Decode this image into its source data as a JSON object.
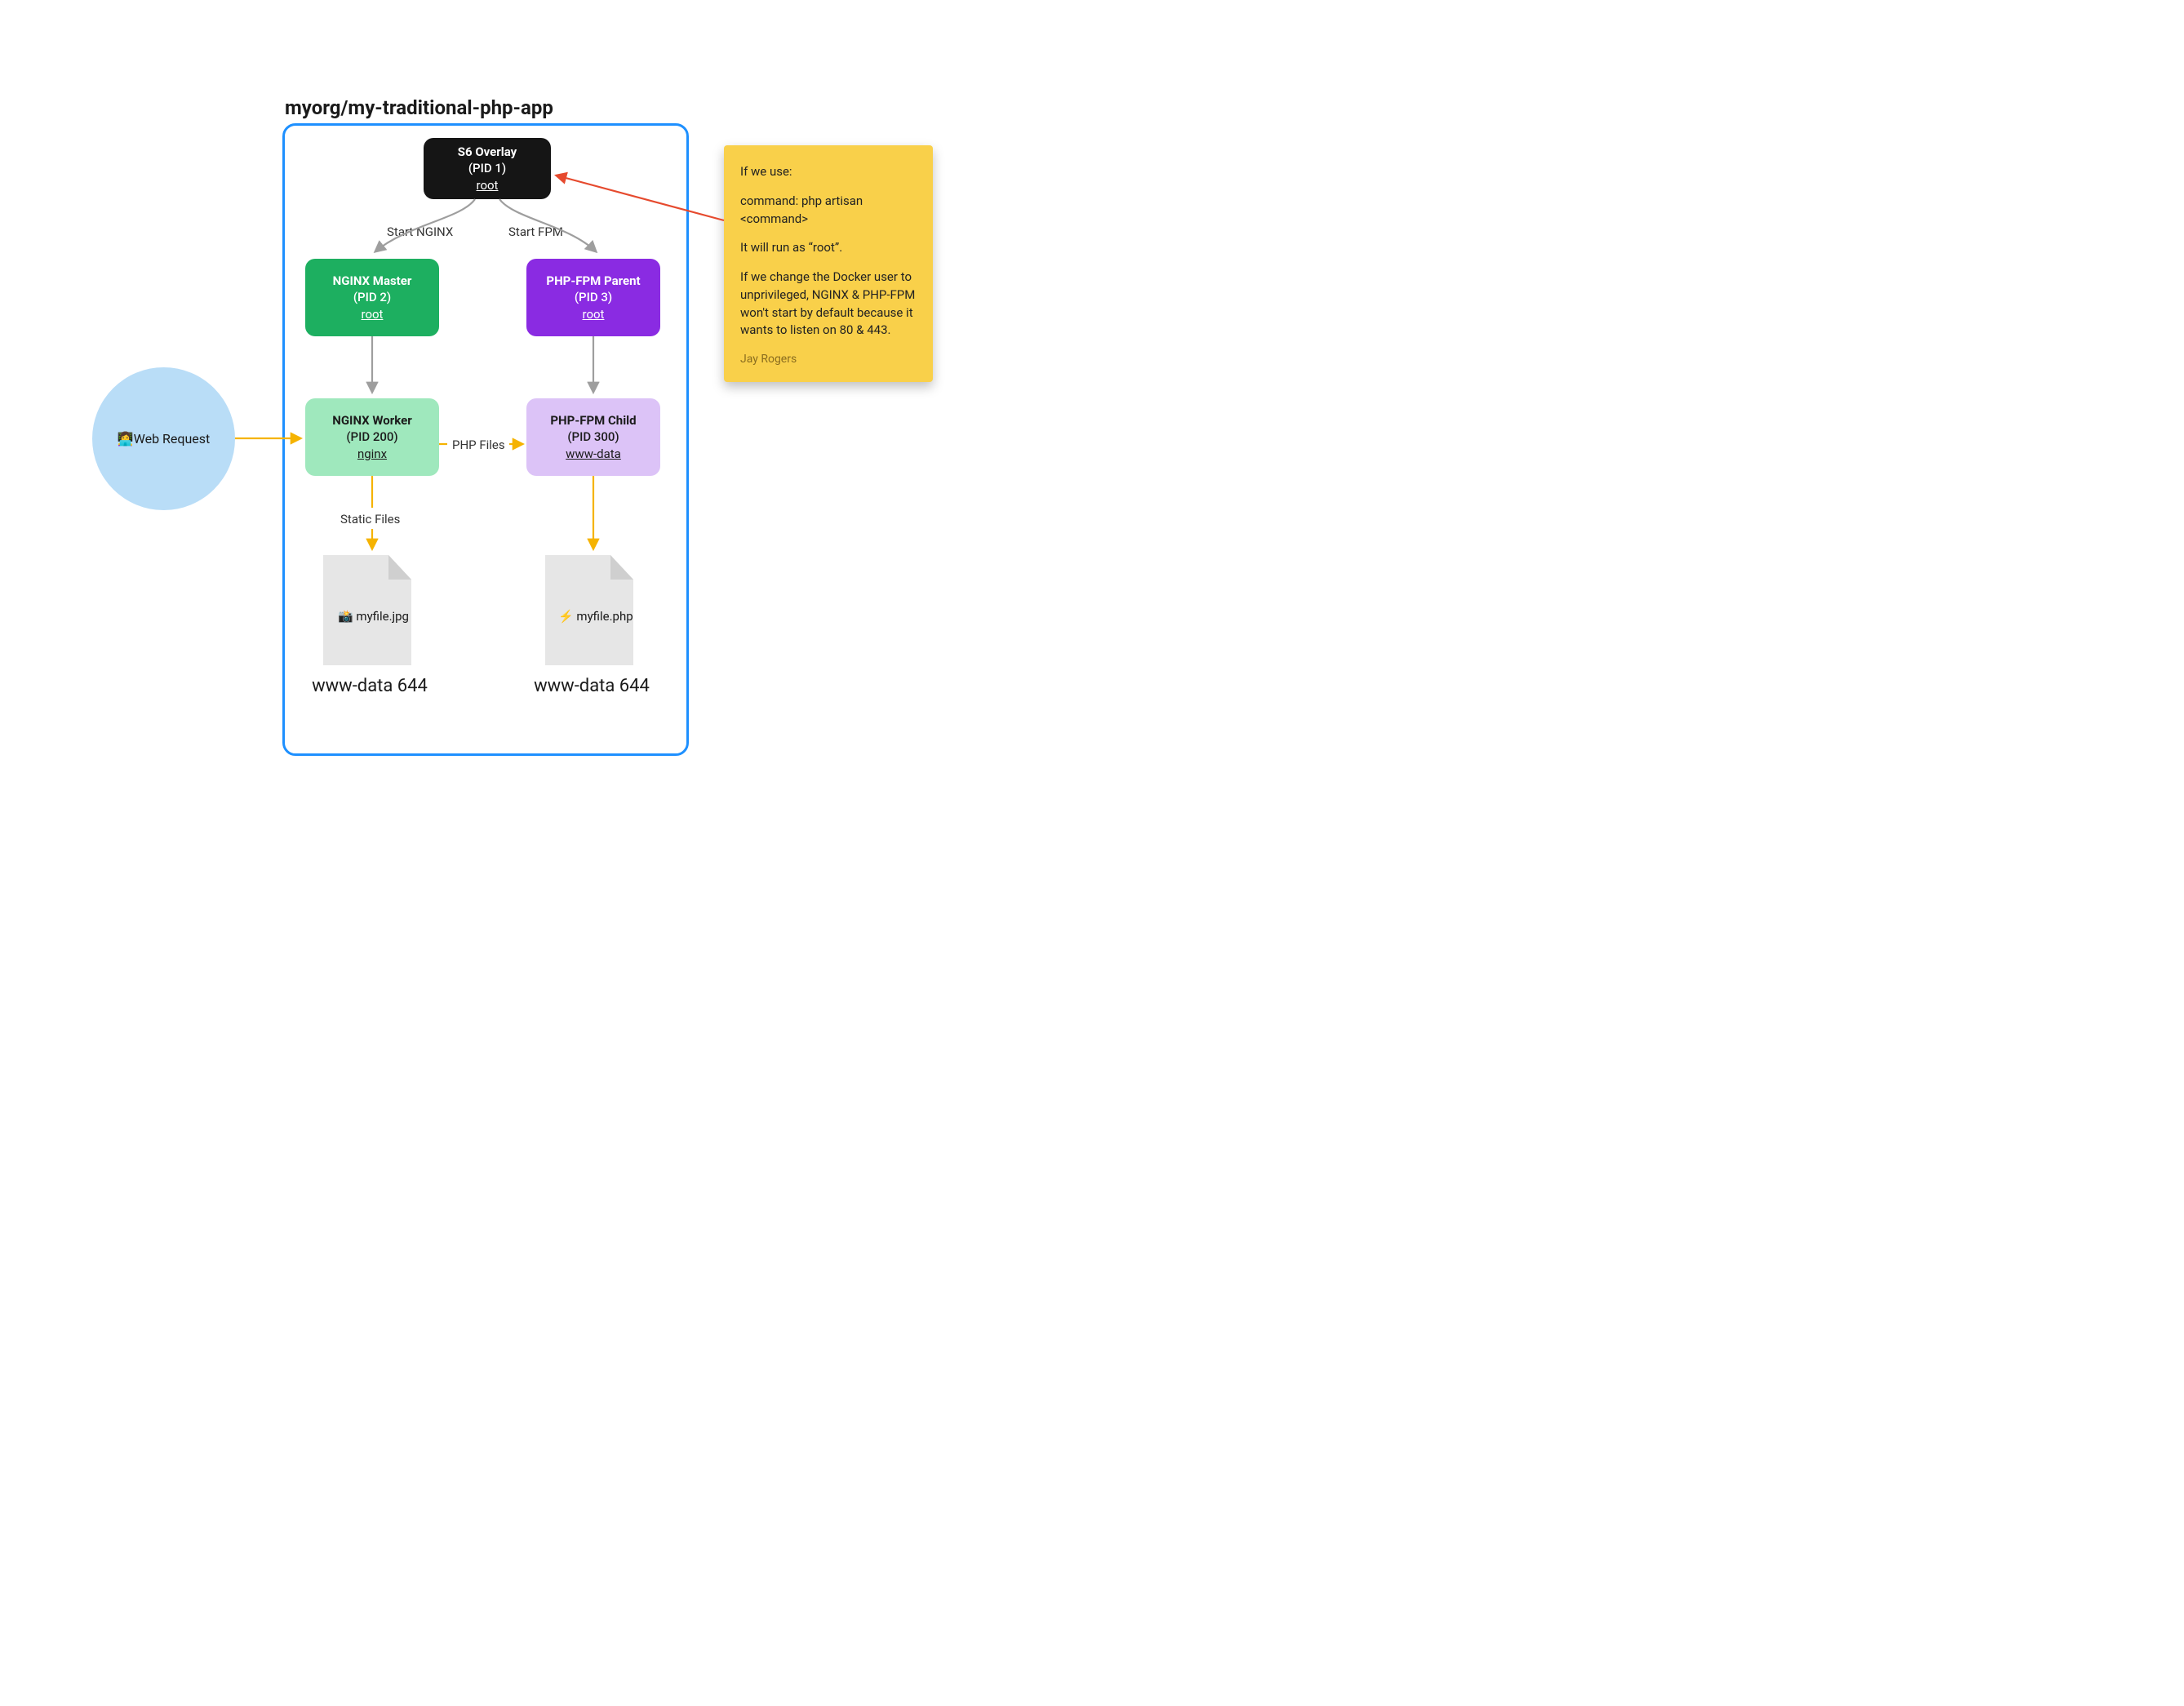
{
  "title": "myorg/my-traditional-php-app",
  "nodes": {
    "s6": {
      "title": "S6 Overlay",
      "pid": "(PID 1)",
      "user": "root"
    },
    "ngm": {
      "title": "NGINX Master",
      "pid": "(PID 2)",
      "user": "root"
    },
    "ngw": {
      "title": "NGINX Worker",
      "pid": "(PID 200)",
      "user": "nginx"
    },
    "fpmp": {
      "title": "PHP-FPM Parent",
      "pid": "(PID 3)",
      "user": "root"
    },
    "fpmc": {
      "title": "PHP-FPM Child",
      "pid": "(PID 300)",
      "user": "www-data"
    }
  },
  "edges": {
    "start_nginx": "Start NGINX",
    "start_fpm": "Start FPM",
    "php_files": "PHP Files",
    "static_files": "Static Files"
  },
  "web_request": {
    "emoji": "👩‍💻",
    "label": " Web Request"
  },
  "files": {
    "jpg": {
      "emoji": "📸",
      "name": " myfile.jpg",
      "owner": "www-data 644"
    },
    "php": {
      "emoji": "⚡",
      "name": " myfile.php",
      "owner": "www-data 644"
    }
  },
  "note": {
    "p1": "If we use:",
    "p2": "command: php artisan <command>",
    "p3": "It will run as “root”.",
    "p4": "If we change the Docker user to unprivileged, NGINX & PHP-FPM won't start by default because it wants to listen on 80 & 443.",
    "sig": "Jay Rogers"
  },
  "colors": {
    "arrow_gray": "#9E9E9E",
    "arrow_yellow": "#F5B301",
    "arrow_red": "#E64A2E"
  }
}
